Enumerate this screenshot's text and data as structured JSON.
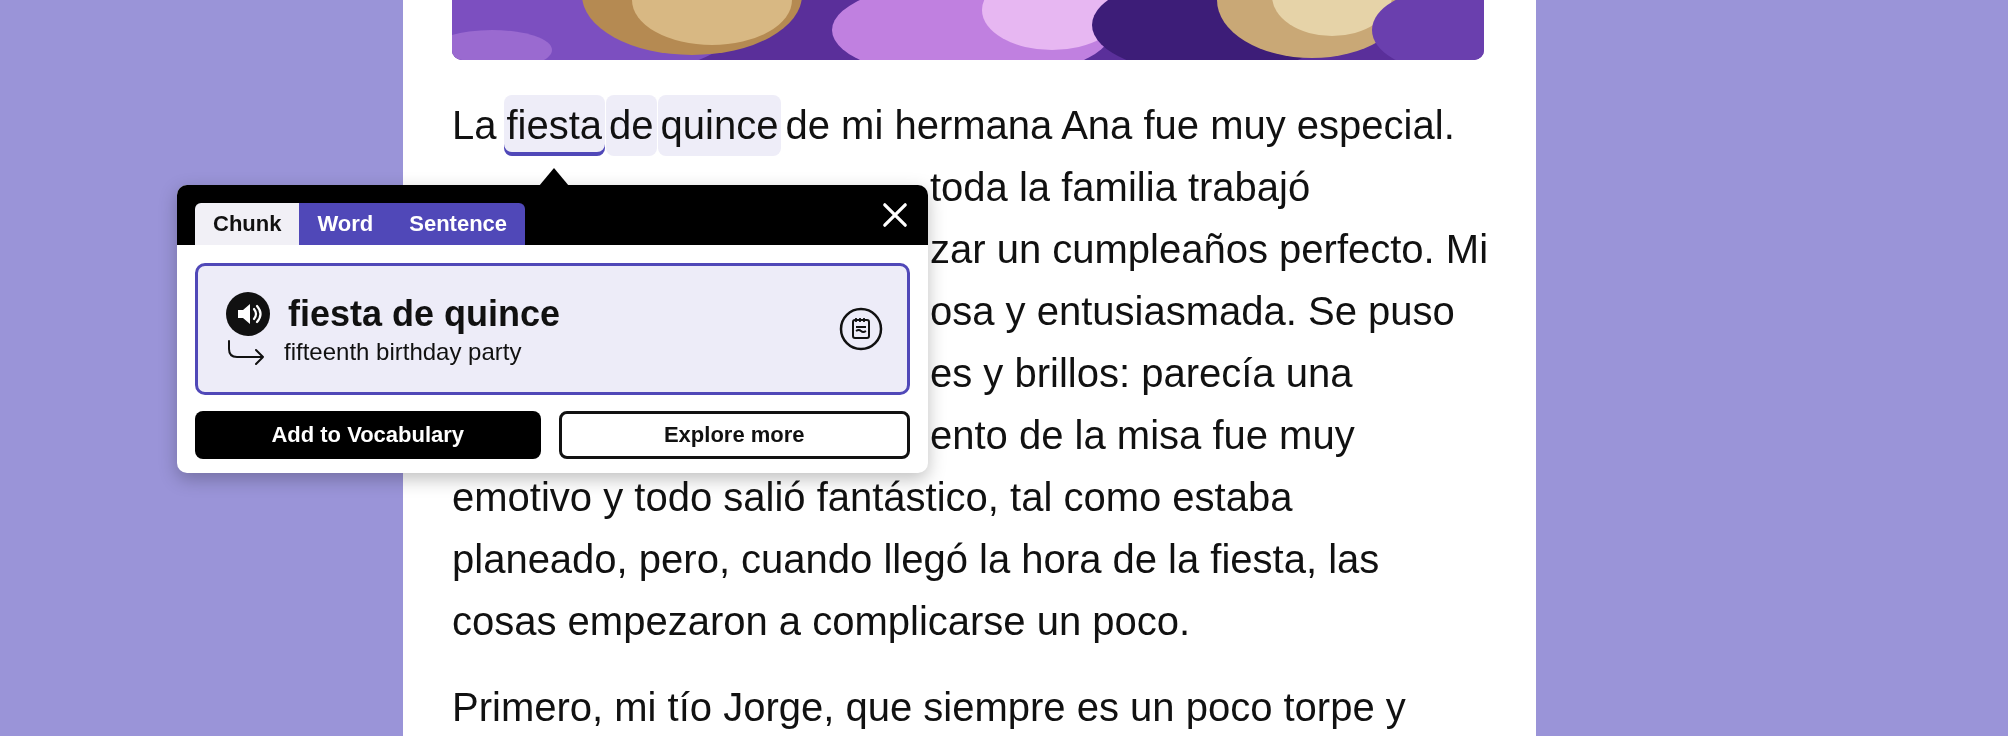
{
  "reading": {
    "paragraphs": [
      {
        "lines": [
          {
            "kind": "chunked",
            "before": "La",
            "chunk_words": [
              {
                "text": "fiesta",
                "selected": true
              },
              {
                "text": "de",
                "selected": false
              },
              {
                "text": "quince",
                "selected": false
              }
            ],
            "after": "de mi hermana Ana fue muy especial."
          },
          {
            "kind": "partial",
            "text": "toda la familia trabajó"
          },
          {
            "kind": "partial",
            "text": "zar un cumpleaños perfecto. Mi"
          },
          {
            "kind": "partial",
            "text": "osa y entusiasmada. Se puso"
          },
          {
            "kind": "partial",
            "text": "es y brillos: parecía una"
          },
          {
            "kind": "partial",
            "text": "ento de la misa fue muy"
          },
          {
            "kind": "full",
            "text": "emotivo y todo salió fantástico, tal como estaba"
          },
          {
            "kind": "full",
            "text": "planeado, pero, cuando llegó la hora de la fiesta, las"
          },
          {
            "kind": "full",
            "text": "cosas empezaron a complicarse un poco."
          }
        ]
      },
      {
        "lines": [
          {
            "kind": "full",
            "text": "Primero, mi tío Jorge, que siempre es un poco torpe y"
          }
        ]
      }
    ]
  },
  "popup": {
    "tabs": [
      {
        "label": "Chunk",
        "selected": true
      },
      {
        "label": "Word",
        "selected": false
      },
      {
        "label": "Sentence",
        "selected": false
      }
    ],
    "card": {
      "headword": "fiesta de quince",
      "translation": "fifteenth birthday party"
    },
    "buttons": [
      {
        "label": "Add to Vocabulary",
        "kind": "primary"
      },
      {
        "label": "Explore more",
        "kind": "secondary"
      }
    ]
  }
}
